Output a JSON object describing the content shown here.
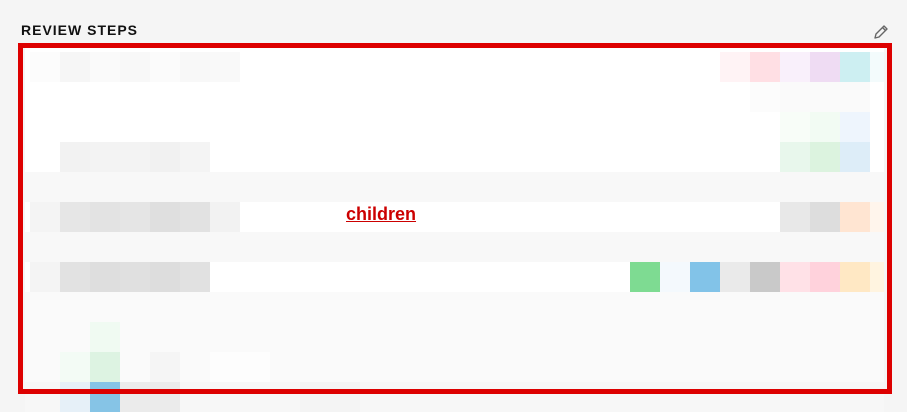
{
  "section": {
    "title": "REVIEW STEPS",
    "edit_icon": "pencil-icon"
  },
  "overlay": {
    "label": "children",
    "color": "#dd0000"
  }
}
